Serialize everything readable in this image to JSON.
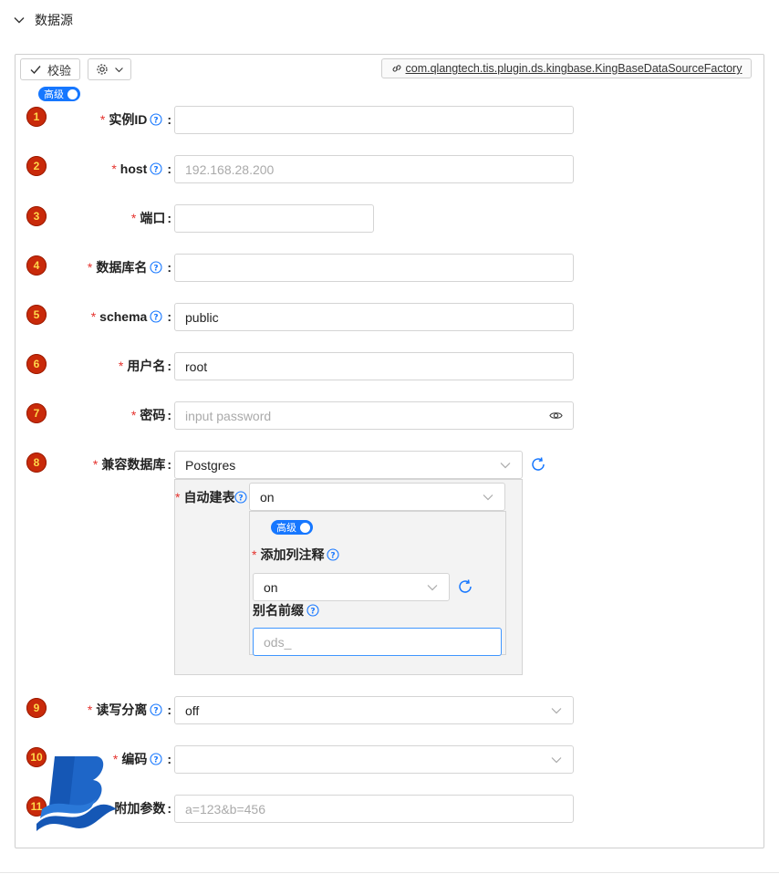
{
  "section": {
    "title": "数据源"
  },
  "toolbar": {
    "validate_label": "校验",
    "factory_link": "com.qlangtech.tis.plugin.ds.kingbase.KingBaseDataSourceFactory"
  },
  "advanced_switch": {
    "label": "高级",
    "on": true
  },
  "fields": [
    {
      "num": "1",
      "label": "实例ID",
      "required": true,
      "help": true,
      "value": "",
      "placeholder": ""
    },
    {
      "num": "2",
      "label": "host",
      "required": true,
      "help": true,
      "value": "",
      "placeholder": "192.168.28.200"
    },
    {
      "num": "3",
      "label": "端口",
      "required": true,
      "help": false,
      "value": "",
      "placeholder": ""
    },
    {
      "num": "4",
      "label": "数据库名",
      "required": true,
      "help": true,
      "value": "",
      "placeholder": ""
    },
    {
      "num": "5",
      "label": "schema",
      "required": true,
      "help": true,
      "value": "public",
      "placeholder": ""
    },
    {
      "num": "6",
      "label": "用户名",
      "required": true,
      "help": false,
      "value": "root",
      "placeholder": ""
    },
    {
      "num": "7",
      "label": "密码",
      "required": true,
      "help": false,
      "value": "",
      "placeholder": "input password"
    },
    {
      "num": "8",
      "label": "兼容数据库",
      "required": true,
      "help": false,
      "value": "Postgres",
      "placeholder": ""
    },
    {
      "num": "9",
      "label": "读写分离",
      "required": true,
      "help": true,
      "value": "off",
      "placeholder": ""
    },
    {
      "num": "10",
      "label": "编码",
      "required": true,
      "help": true,
      "value": "",
      "placeholder": ""
    },
    {
      "num": "11",
      "label": "附加参数",
      "required": false,
      "help": false,
      "value": "",
      "placeholder": "a=123&b=456"
    }
  ],
  "nested": {
    "auto_create_label": "自动建表",
    "auto_create_value": "on",
    "advanced_label": "高级",
    "add_comment_label": "添加列注释",
    "add_comment_value": "on",
    "alias_prefix_label": "别名前缀",
    "alias_prefix_placeholder": "ods_"
  },
  "colors": {
    "accent": "#1677ff",
    "required": "#e5322d",
    "badge": "#c92a0a"
  }
}
